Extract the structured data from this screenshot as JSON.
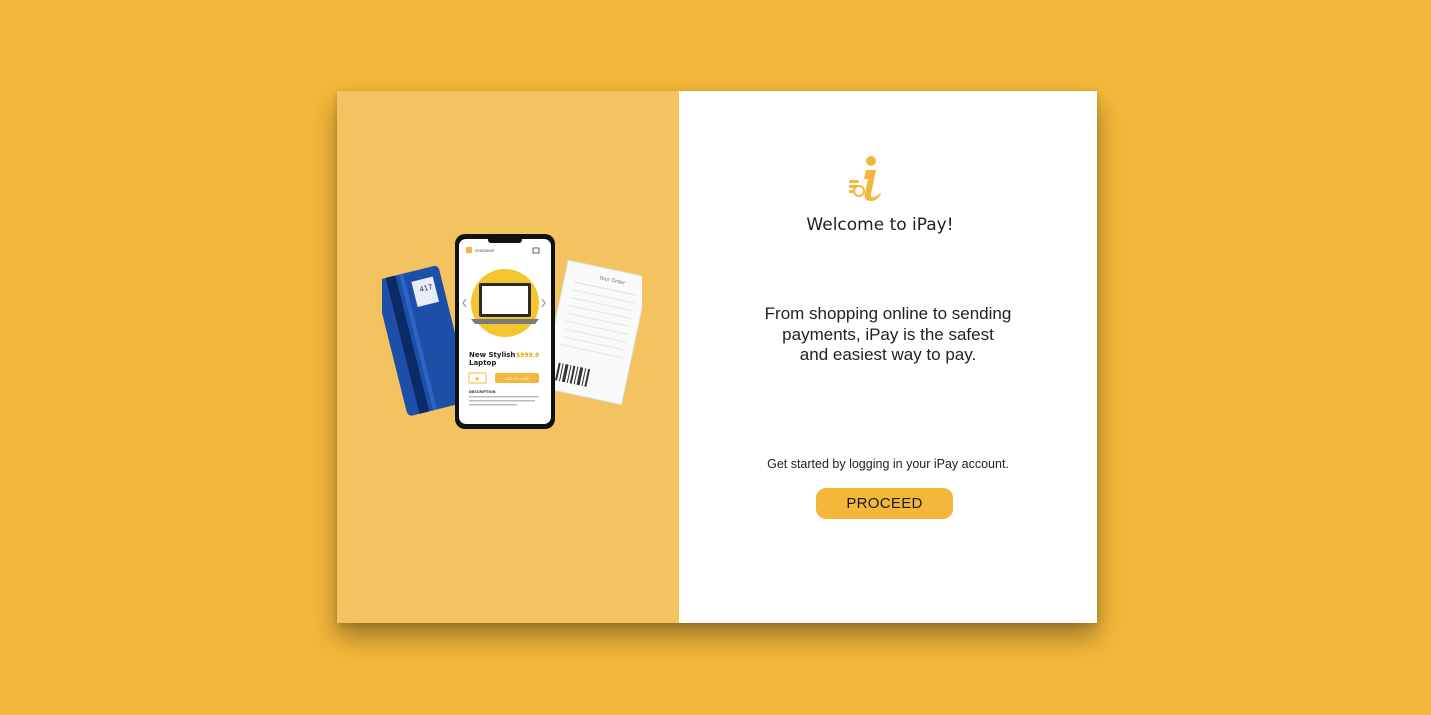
{
  "colors": {
    "background": "#F3B73A",
    "left_panel": "#F3C35F",
    "right_panel": "#FFFFFF",
    "accent": "#F3B73A"
  },
  "illustration": {
    "phone_product_title_line1": "New Stylish",
    "phone_product_title_line2": "Laptop",
    "phone_product_price": "$999.9",
    "phone_add_to_cart": "ADD TO CART",
    "phone_shop_name": "YOURSHOP",
    "phone_description_label": "DESCRIPTION",
    "receipt_title": "Your Order",
    "card_digits": "417"
  },
  "logo": {
    "icon": "ipay-logo-icon"
  },
  "welcome": {
    "title": "Welcome to iPay!",
    "tagline_line1": "From shopping online to sending",
    "tagline_line2": "payments, iPay is the safest",
    "tagline_line3": "and easiest way to pay.",
    "get_started": "Get started by logging in your iPay account.",
    "proceed_label": "PROCEED"
  }
}
